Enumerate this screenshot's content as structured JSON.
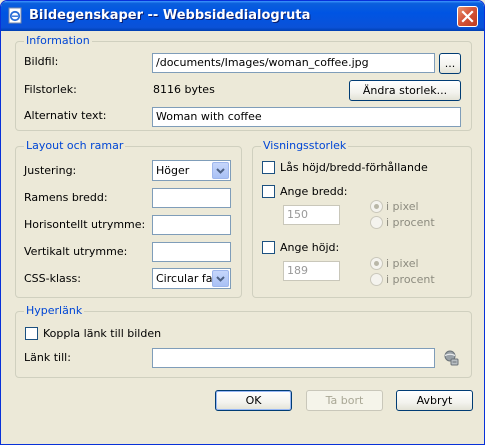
{
  "window": {
    "title": "Bildegenskaper -- Webbsidedialogruta"
  },
  "information": {
    "legend": "Information",
    "bildfil_label": "Bildfil:",
    "bildfil_value": "/documents/Images/woman_coffee.jpg",
    "browse_label": "...",
    "filstorlek_label": "Filstorlek:",
    "filstorlek_value": "8116 bytes",
    "resize_label": "Ändra storlek...",
    "alt_label": "Alternativ text:",
    "alt_value": "Woman with coffee"
  },
  "layout": {
    "legend": "Layout och ramar",
    "justering_label": "Justering:",
    "justering_value": "Höger",
    "ram_label": "Ramens bredd:",
    "ram_value": "",
    "horiz_label": "Horisontellt utrymme:",
    "horiz_value": "",
    "vert_label": "Vertikalt utrymme:",
    "vert_value": "",
    "css_label": "CSS-klass:",
    "css_value": "Circular fade"
  },
  "visning": {
    "legend": "Visningsstorlek",
    "lock_label": "Lås höjd/bredd-förhållande",
    "width_label": "Ange bredd:",
    "width_value": "150",
    "height_label": "Ange höjd:",
    "height_value": "189",
    "pixel_label": "i pixel",
    "percent_label": "i procent"
  },
  "hyperlink": {
    "legend": "Hyperlänk",
    "link_check_label": "Koppla länk till bilden",
    "link_to_label": "Länk till:",
    "link_to_value": ""
  },
  "buttons": {
    "ok": "OK",
    "remove": "Ta bort",
    "cancel": "Avbryt"
  },
  "icons": {
    "app": "ie-page-icon",
    "close": "close-icon",
    "link_browse": "link-browse-icon"
  }
}
